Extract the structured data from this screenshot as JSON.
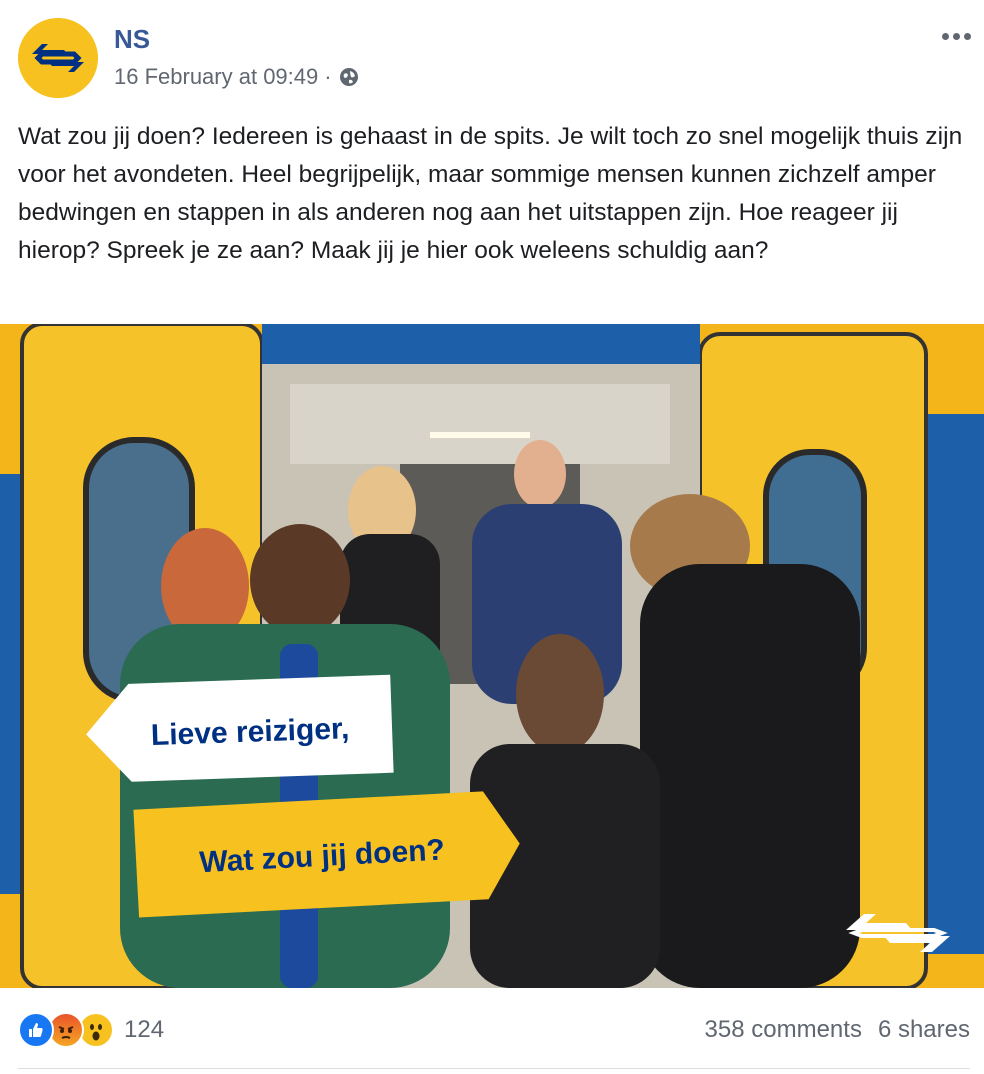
{
  "post": {
    "page_name": "NS",
    "timestamp": "16 February at 09:49",
    "separator": "·",
    "privacy_icon": "globe-icon",
    "more_icon": "more-options-icon",
    "text": "Wat zou jij doen? Iedereen is gehaast in de spits. Je wilt toch zo snel mogelijk thuis zijn voor het avondeten. Heel begrijpelijk, maar sommige mensen kunnen zichzelf amper bedwingen en stappen in als anderen nog aan het uitstappen zijn. Hoe reageer jij hierop? Spreek je ze aan? Maak jij je hier ook weleens schuldig aan?"
  },
  "image": {
    "sign_top": "Lieve reiziger,",
    "sign_bottom": "Wat zou jij doen?",
    "brand_yellow": "#f7c21f",
    "brand_blue": "#003082"
  },
  "footer": {
    "reactions": [
      "like-icon",
      "angry-icon",
      "wow-icon"
    ],
    "reaction_count": "124",
    "comments": "358 comments",
    "shares": "6 shares"
  }
}
